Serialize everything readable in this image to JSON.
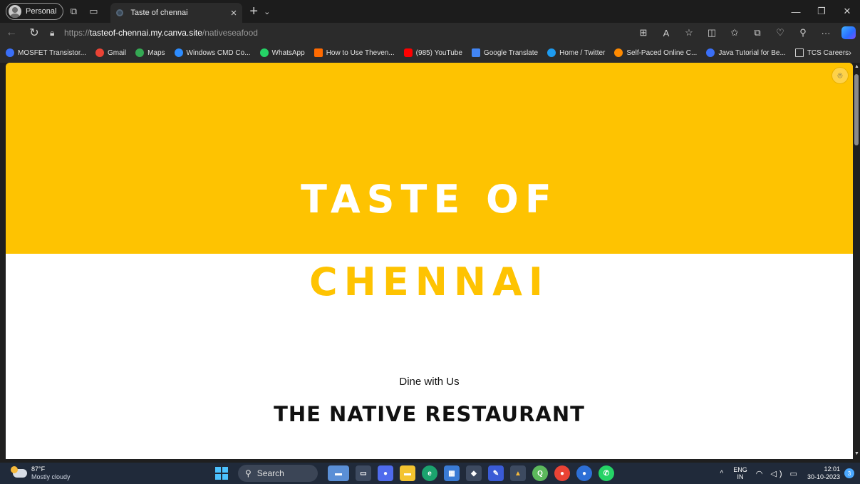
{
  "browser": {
    "profile_label": "Personal",
    "tab_title": "Taste of chennai",
    "url_scheme": "https://",
    "url_host": "tasteof-chennai.my.canva.site",
    "url_path": "/nativeseafood"
  },
  "bookmarks": [
    {
      "label": "MOSFET Transistor...",
      "color": "#3a6ff7"
    },
    {
      "label": "Gmail",
      "color": "#ea4335"
    },
    {
      "label": "Maps",
      "color": "#34a853"
    },
    {
      "label": "Windows CMD Co...",
      "color": "#2d8cff"
    },
    {
      "label": "WhatsApp",
      "color": "#25d366"
    },
    {
      "label": "How to Use Theven...",
      "color": "#ff6a00"
    },
    {
      "label": "(985) YouTube",
      "color": "#ff0000"
    },
    {
      "label": "Google Translate",
      "color": "#4285f4"
    },
    {
      "label": "Home / Twitter",
      "color": "#1d9bf0"
    },
    {
      "label": "Self-Paced Online C...",
      "color": "#ff8a00"
    },
    {
      "label": "Java Tutorial for Be...",
      "color": "#3a6ff7"
    },
    {
      "label": "TCS Careers",
      "color": "#cfcfcf"
    }
  ],
  "page": {
    "title_line1": "TASTE OF",
    "title_line2": "CHENNAI",
    "tagline": "Dine with Us",
    "restaurant_name": "THE NATIVE RESTAURANT",
    "accent_color": "#fec301"
  },
  "taskbar": {
    "temperature": "87°F",
    "condition": "Mostly cloudy",
    "search_label": "Search",
    "lang_line1": "ENG",
    "lang_line2": "IN",
    "time": "12:01",
    "date": "30-10-2023",
    "notification_count": "3"
  }
}
